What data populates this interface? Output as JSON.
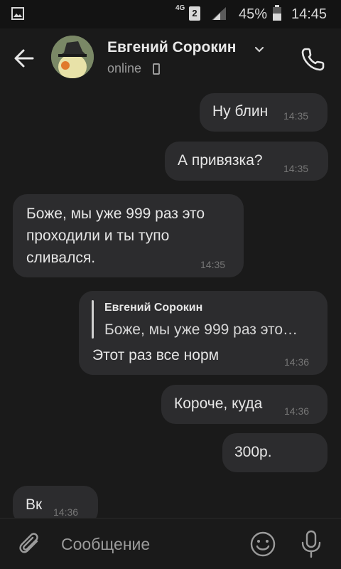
{
  "status_bar": {
    "network": "4G",
    "sim_slot": "2",
    "battery_percent": "45%",
    "time": "14:45"
  },
  "header": {
    "contact_name": "Евгений Сорокин",
    "status": "online",
    "icons": [
      "back-arrow-icon",
      "chevron-down-icon",
      "mobile-phone-icon",
      "call-icon"
    ]
  },
  "messages": [
    {
      "direction": "out",
      "text": "Ну блин",
      "time": "14:35"
    },
    {
      "direction": "out",
      "text": "А привязка?",
      "time": "14:35"
    },
    {
      "direction": "in",
      "text": "Боже, мы уже 999 раз это проходили и ты тупо сливался.",
      "time": "14:35"
    },
    {
      "direction": "out",
      "reply_author": "Евгений Сорокин",
      "reply_text": "Боже, мы уже 999 раз это…",
      "text": "Этот раз все норм",
      "time": "14:36"
    },
    {
      "direction": "out",
      "text": "Короче, куда",
      "time": "14:36"
    },
    {
      "direction": "out",
      "text": "300р.",
      "time": ""
    },
    {
      "direction": "in",
      "text": "Вк",
      "time": "14:36"
    }
  ],
  "composer": {
    "placeholder": "Сообщение",
    "value": ""
  },
  "colors": {
    "background": "#1a1a1a",
    "bubble": "#2c2c2e",
    "text": "#e6e6e6",
    "muted": "#767676"
  }
}
